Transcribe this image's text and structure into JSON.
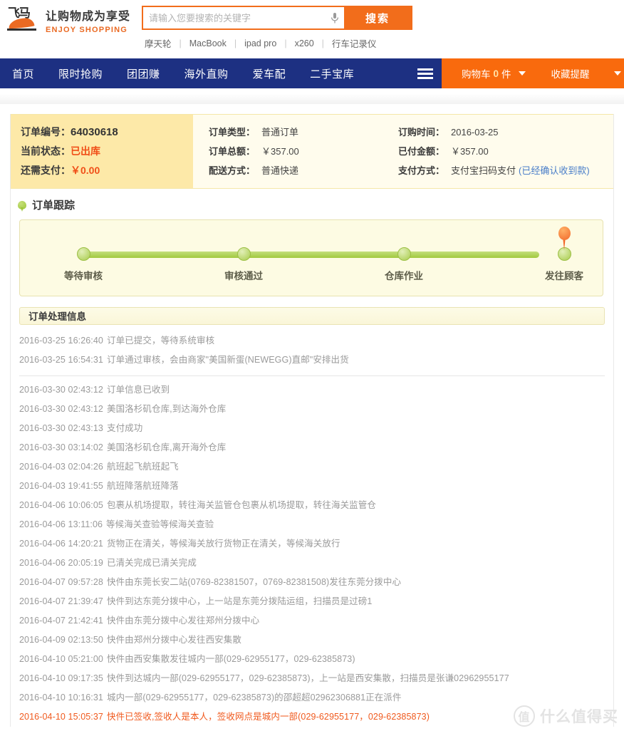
{
  "header": {
    "logo": {
      "glyph": "飞马",
      "slogan_cn": "让购物成为享受",
      "slogan_en": "ENJOY SHOPPING"
    },
    "search": {
      "placeholder": "请输入您要搜索的关键字",
      "value": "",
      "button_label": "搜索",
      "mic_icon": "microphone-icon"
    },
    "hot_words": [
      "摩天轮",
      "MacBook",
      "ipad pro",
      "x260",
      "行车记录仪"
    ],
    "hot_separator": "|"
  },
  "nav": {
    "items": [
      "首页",
      "限时抢购",
      "团团赚",
      "海外直购",
      "爱车配",
      "二手宝库"
    ],
    "menu_icon": "hamburger-menu-icon",
    "cart": {
      "label": "购物车",
      "count": "0",
      "unit": "件",
      "caret_icon": "chevron-down-icon"
    },
    "favorites": {
      "label": "收藏提醒",
      "caret_icon": "chevron-down-icon"
    },
    "colors": {
      "nav_bg": "#1d3082",
      "accent_orange": "#f96a0d"
    }
  },
  "order": {
    "left": [
      {
        "label": "订单编号：",
        "value": "64030618",
        "style": "strong"
      },
      {
        "label": "当前状态：",
        "value": "已出库",
        "style": "orange"
      },
      {
        "label": "还需支付：",
        "value": "￥0.00",
        "style": "orange"
      }
    ],
    "middle": [
      {
        "label": "订单类型：",
        "value": "普通订单"
      },
      {
        "label": "订单总额：",
        "value": "￥357.00"
      },
      {
        "label": "配送方式：",
        "value": "普通快递"
      }
    ],
    "right": [
      {
        "label": "订购时间：",
        "value": "2016-03-25",
        "note": ""
      },
      {
        "label": "已付金额：",
        "value": "￥357.00",
        "note": ""
      },
      {
        "label": "支付方式：",
        "value": "支付宝扫码支付",
        "note": "(已经确认收到款)"
      }
    ]
  },
  "tracking": {
    "section_title": "订单跟踪",
    "pin_icon": "location-pin-icon",
    "marker_icon": "current-step-marker-icon",
    "steps": [
      "等待审核",
      "审核通过",
      "仓库作业",
      "发往顾客"
    ],
    "current_step_index": 3
  },
  "log": {
    "header": "订单处理信息",
    "entries": [
      {
        "time": "2016-03-25 16:26:40",
        "text": "订单已提交，等待系统审核",
        "highlight": false,
        "separator_after": false
      },
      {
        "time": "2016-03-25 16:54:31",
        "text": "订单通过审核，会由商家\"美国新蛋(NEWEGG)直邮\"安排出货",
        "highlight": false,
        "separator_after": true
      },
      {
        "time": "2016-03-30 02:43:12",
        "text": "订单信息已收到",
        "highlight": false,
        "separator_after": false
      },
      {
        "time": "2016-03-30 02:43:12",
        "text": "美国洛杉矶仓库,到达海外仓库",
        "highlight": false,
        "separator_after": false
      },
      {
        "time": "2016-03-30 02:43:13",
        "text": "支付成功",
        "highlight": false,
        "separator_after": false
      },
      {
        "time": "2016-03-30 03:14:02",
        "text": "美国洛杉矶仓库,离开海外仓库",
        "highlight": false,
        "separator_after": false
      },
      {
        "time": "2016-04-03 02:04:26",
        "text": "航班起飞航班起飞",
        "highlight": false,
        "separator_after": false
      },
      {
        "time": "2016-04-03 19:41:55",
        "text": "航班降落航班降落",
        "highlight": false,
        "separator_after": false
      },
      {
        "time": "2016-04-06 10:06:05",
        "text": "包裹从机场提取，转往海关监管仓包裹从机场提取，转往海关监管仓",
        "highlight": false,
        "separator_after": false
      },
      {
        "time": "2016-04-06 13:11:06",
        "text": "等候海关查验等候海关查验",
        "highlight": false,
        "separator_after": false
      },
      {
        "time": "2016-04-06 14:20:21",
        "text": "货物正在清关，等候海关放行货物正在清关，等候海关放行",
        "highlight": false,
        "separator_after": false
      },
      {
        "time": "2016-04-06 20:05:19",
        "text": "已清关完成已清关完成",
        "highlight": false,
        "separator_after": false
      },
      {
        "time": "2016-04-07 09:57:28",
        "text": "快件由东莞长安二站(0769-82381507，0769-82381508)发往东莞分拨中心",
        "highlight": false,
        "separator_after": false
      },
      {
        "time": "2016-04-07 21:39:47",
        "text": "快件到达东莞分拨中心，上一站是东莞分拨陆运组，扫描员是过磅1",
        "highlight": false,
        "separator_after": false
      },
      {
        "time": "2016-04-07 21:42:41",
        "text": "快件由东莞分拨中心发往郑州分拨中心",
        "highlight": false,
        "separator_after": false
      },
      {
        "time": "2016-04-09 02:13:50",
        "text": "快件由郑州分拨中心发往西安集散",
        "highlight": false,
        "separator_after": false
      },
      {
        "time": "2016-04-10 05:21:00",
        "text": "快件由西安集散发往城内一部(029-62955177，029-62385873)",
        "highlight": false,
        "separator_after": false
      },
      {
        "time": "2016-04-10 09:17:35",
        "text": "快件到达城内一部(029-62955177，029-62385873)，上一站是西安集散，扫描员是张谦02962955177",
        "highlight": false,
        "separator_after": false
      },
      {
        "time": "2016-04-10 10:16:31",
        "text": "城内一部(029-62955177，029-62385873)的邵超超02962306881正在派件",
        "highlight": false,
        "separator_after": false
      },
      {
        "time": "2016-04-10 15:05:37",
        "text": "快件已签收,签收人是本人，签收网点是城内一部(029-62955177，029-62385873)",
        "highlight": true,
        "separator_after": false
      }
    ]
  },
  "watermark": {
    "circle_text": "值",
    "text": "什么值得买"
  }
}
